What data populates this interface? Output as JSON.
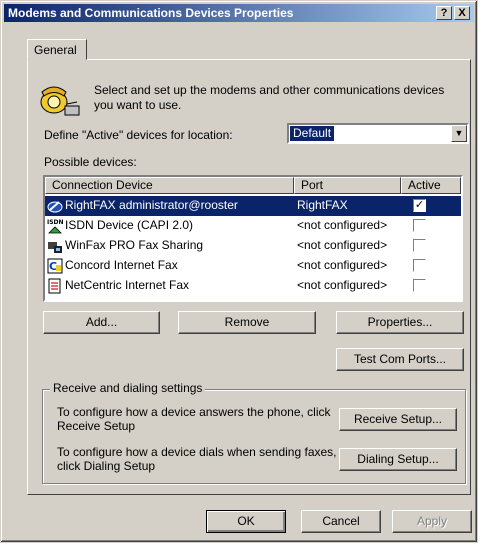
{
  "window": {
    "title": "Modems and Communications Devices Properties",
    "help_btn": "?",
    "close_btn": "X"
  },
  "tabs": [
    {
      "label": "General"
    }
  ],
  "intro": {
    "text": "Select and set up the modems and other communications devices you want to use.",
    "icon": "telephone-icon"
  },
  "location": {
    "label": "Define \"Active\" devices for location:",
    "value": "Default",
    "dropdown_arrow": "▼"
  },
  "devices": {
    "label": "Possible devices:",
    "columns": [
      "Connection Device",
      "Port",
      "Active"
    ],
    "rows": [
      {
        "name": "RightFAX administrator@rooster",
        "port": "RightFAX",
        "active": "✓",
        "icon": "rightfax-icon",
        "selected": true
      },
      {
        "name": "ISDN Device (CAPI 2.0)",
        "port": "<not configured>",
        "active": "",
        "icon": "isdn-icon",
        "selected": false
      },
      {
        "name": "WinFax PRO Fax Sharing",
        "port": "<not configured>",
        "active": "",
        "icon": "winfax-icon",
        "selected": false
      },
      {
        "name": "Concord Internet Fax",
        "port": "<not configured>",
        "active": "",
        "icon": "concord-icon",
        "selected": false
      },
      {
        "name": "NetCentric Internet Fax",
        "port": "<not configured>",
        "active": "",
        "icon": "netcentric-icon",
        "selected": false
      }
    ]
  },
  "buttons": {
    "add": "Add...",
    "remove": "Remove",
    "properties": "Properties...",
    "test_ports": "Test Com Ports..."
  },
  "group": {
    "legend": "Receive and dialing settings",
    "receive_text": "To configure how a device answers the phone, click Receive Setup",
    "receive_btn": "Receive Setup...",
    "dial_text": "To configure how a device dials when sending faxes, click Dialing Setup",
    "dial_btn": "Dialing Setup..."
  },
  "footer": {
    "ok": "OK",
    "cancel": "Cancel",
    "apply": "Apply"
  },
  "colors": {
    "face": "#d4d0c8",
    "title_start": "#0a246a",
    "title_end": "#a6caf0",
    "selection": "#0a246a"
  }
}
